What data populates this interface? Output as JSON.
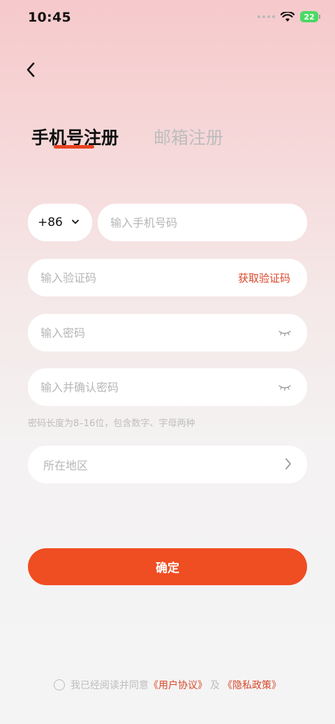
{
  "status_bar": {
    "time": "10:45",
    "battery": "22"
  },
  "header": {
    "back_icon": "chevron-left-icon"
  },
  "tabs": [
    {
      "label": "手机号注册",
      "active": true
    },
    {
      "label": "邮箱注册",
      "active": false
    }
  ],
  "form": {
    "country_code": "+86",
    "phone_placeholder": "输入手机号码",
    "code_placeholder": "输入验证码",
    "get_code_label": "获取验证码",
    "password_placeholder": "输入密码",
    "confirm_password_placeholder": "输入并确认密码",
    "password_hint": "密码长度为8–16位，包含数字、字母两种",
    "region_placeholder": "所在地区",
    "submit_label": "确定"
  },
  "agreement": {
    "text": "我已经阅读并同意",
    "user_agreement": "《用户协议》",
    "and": "及",
    "privacy_policy": "《隐私政策》"
  },
  "colors": {
    "accent": "#ef4d22",
    "link": "#d9472a",
    "placeholder": "#b6b6b6"
  }
}
